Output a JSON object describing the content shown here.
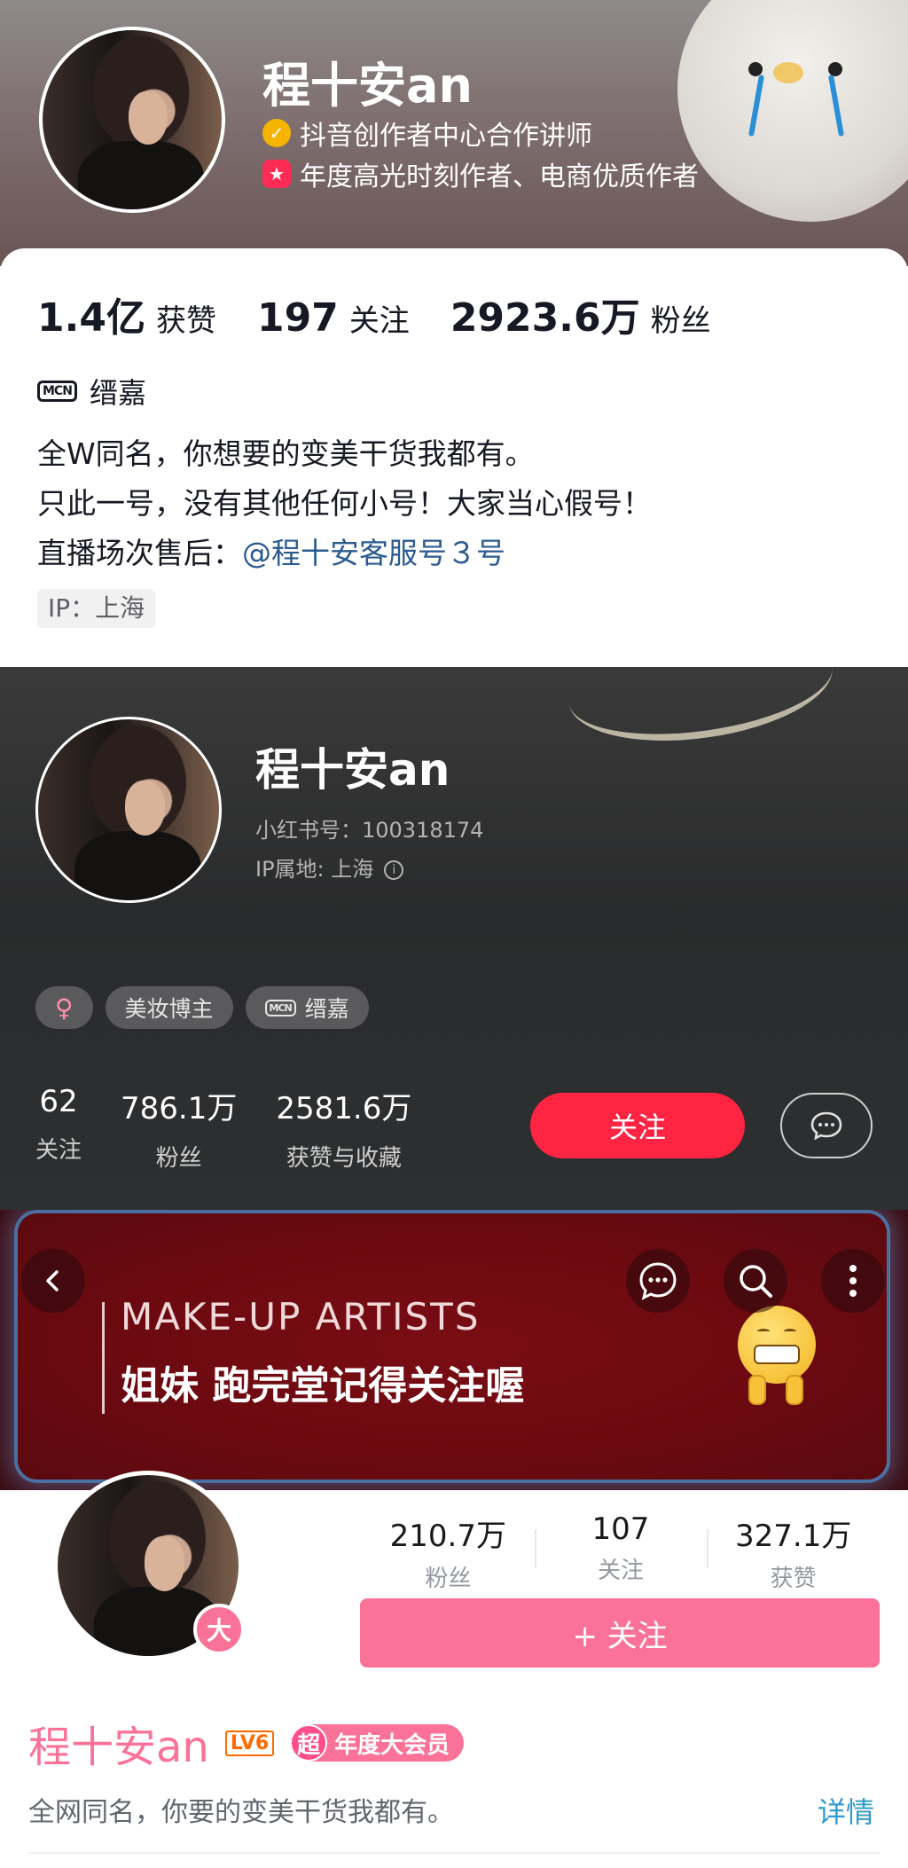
{
  "douyin": {
    "name": "程十安an",
    "badges": [
      {
        "icon": "verified-check-icon",
        "color": "#f4b400",
        "text": "抖音创作者中心合作讲师"
      },
      {
        "icon": "star-medal-icon",
        "color": "#fe2c55",
        "text": "年度高光时刻作者、电商优质作者"
      }
    ],
    "stats": [
      {
        "value": "1.4亿",
        "label": "获赞"
      },
      {
        "value": "197",
        "label": "关注"
      },
      {
        "value": "2923.6万",
        "label": "粉丝"
      }
    ],
    "mcn_icon": "MCN",
    "mcn": "缙嘉",
    "bio": [
      "全W同名，你想要的变美干货我都有。",
      "只此一号，没有其他任何小号！大家当心假号！"
    ],
    "bio_prefix": "直播场次售后：",
    "bio_link": "@程十安客服号３号",
    "ip": "IP：上海"
  },
  "xiaohongshu": {
    "name": "程十安an",
    "id_line": "小红书号：100318174",
    "ip_line": "IP属地: 上海",
    "tags": {
      "gender": "♀",
      "category": "美妆博主",
      "mcn": "缙嘉"
    },
    "stats": [
      {
        "value": "62",
        "label": "关注"
      },
      {
        "value": "786.1万",
        "label": "粉丝"
      },
      {
        "value": "2581.6万",
        "label": "获赞与收藏"
      }
    ],
    "follow_label": "关注",
    "accent": "#ff2442"
  },
  "bilibili": {
    "banner_title": "MAKE-UP ARTISTS",
    "banner_subtitle": "姐妹 跑完堂记得关注喔",
    "avatar_badge": "大",
    "stats": [
      {
        "value": "210.7万",
        "label": "粉丝"
      },
      {
        "value": "107",
        "label": "关注"
      },
      {
        "value": "327.1万",
        "label": "获赞"
      }
    ],
    "follow_label": "+ 关注",
    "name": "程十安an",
    "level": "LV6",
    "vip_prefix": "超",
    "vip_label": "年度大会员",
    "sign": "全网同名，你要的变美干货我都有。",
    "detail_link": "详情",
    "accent": "#fb7299"
  }
}
